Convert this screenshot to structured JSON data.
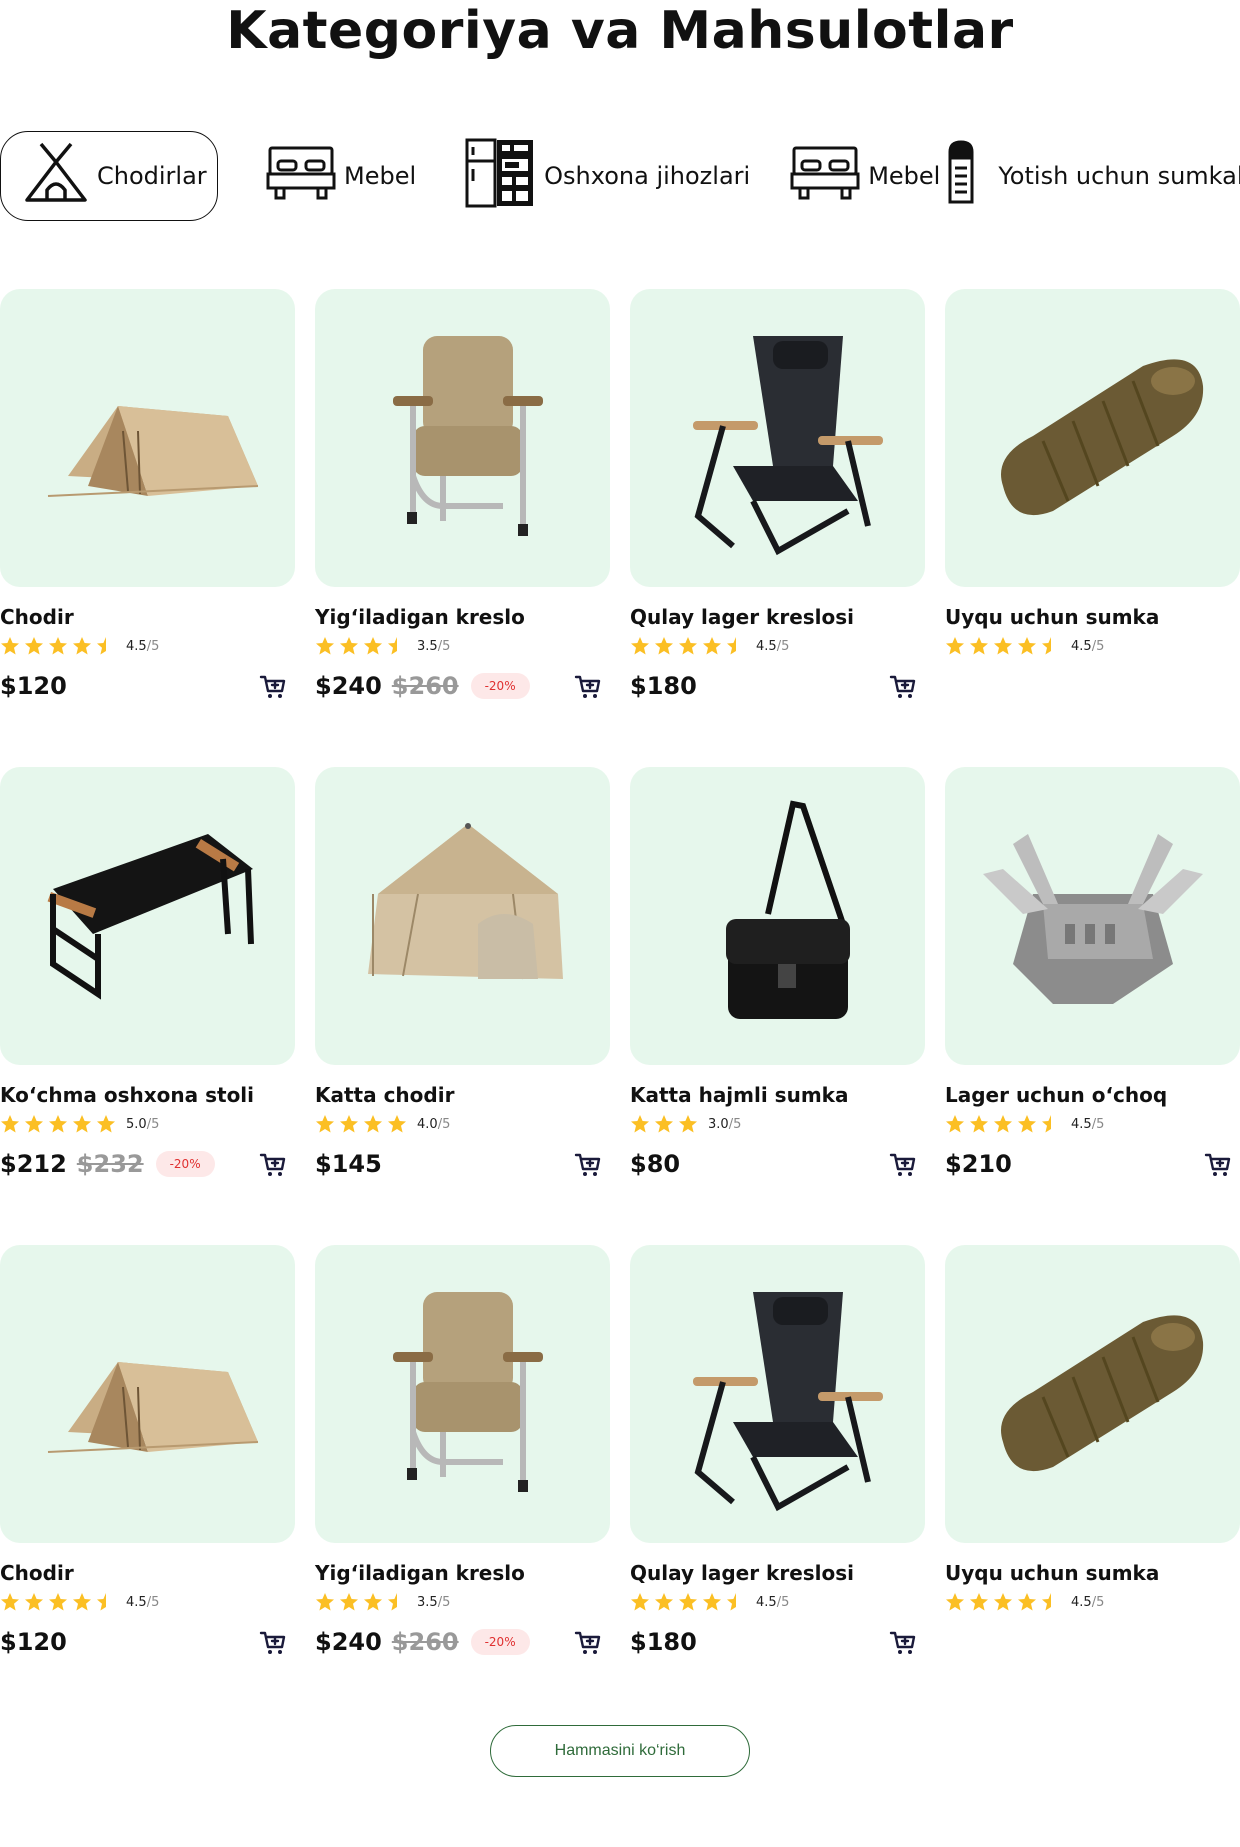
{
  "page": {
    "title": "Kategoriya va Mahsulotlar"
  },
  "categories": [
    {
      "label": "Chodirlar",
      "icon": "tent-icon",
      "active": true
    },
    {
      "label": "Mebel",
      "icon": "bed-icon"
    },
    {
      "label": "Oshxona jihozlari",
      "icon": "kitchen-appliances-icon"
    },
    {
      "label": "Mebel",
      "icon": "bed-icon"
    },
    {
      "label": "Yotish uchun sumkalar",
      "icon": "sleeping-bag-icon"
    }
  ],
  "products": [
    {
      "name": "Chodir",
      "rating": 4.5,
      "rating_text": "4.5",
      "max": "/5",
      "price": "$120",
      "old_price": "",
      "discount": "",
      "image": "small-tent-icon",
      "cart": true
    },
    {
      "name": "Yig‘iladigan kreslo",
      "rating": 3.5,
      "rating_text": "3.5",
      "max": "/5",
      "price": "$240",
      "old_price": "$260",
      "discount": "-20%",
      "image": "folding-chair-icon",
      "cart": true
    },
    {
      "name": "Qulay lager kreslosi",
      "rating": 4.5,
      "rating_text": "4.5",
      "max": "/5",
      "price": "$180",
      "old_price": "",
      "discount": "",
      "image": "camp-chair-icon",
      "cart": true
    },
    {
      "name": "Uyqu uchun sumka",
      "rating": 4.5,
      "rating_text": "4.5",
      "max": "/5",
      "price": "",
      "old_price": "",
      "discount": "",
      "image": "sleeping-bag-icon",
      "cart": false
    },
    {
      "name": "Ko‘chma oshxona stoli",
      "rating": 5.0,
      "rating_text": "5.0",
      "max": "/5",
      "price": "$212",
      "old_price": "$232",
      "discount": "-20%",
      "image": "folding-table-icon",
      "cart": true
    },
    {
      "name": "Katta chodir",
      "rating": 4.0,
      "rating_text": "4.0",
      "max": "/5",
      "price": "$145",
      "old_price": "",
      "discount": "",
      "image": "large-tent-icon",
      "cart": true
    },
    {
      "name": "Katta hajmli sumka",
      "rating": 3.0,
      "rating_text": "3.0",
      "max": "/5",
      "price": "$80",
      "old_price": "",
      "discount": "",
      "image": "shoulder-bag-icon",
      "cart": true
    },
    {
      "name": "Lager uchun o‘choq",
      "rating": 4.5,
      "rating_text": "4.5",
      "max": "/5",
      "price": "$210",
      "old_price": "",
      "discount": "",
      "image": "camp-stove-icon",
      "cart": true
    },
    {
      "name": "Chodir",
      "rating": 4.5,
      "rating_text": "4.5",
      "max": "/5",
      "price": "$120",
      "old_price": "",
      "discount": "",
      "image": "small-tent-icon",
      "cart": true
    },
    {
      "name": "Yig‘iladigan kreslo",
      "rating": 3.5,
      "rating_text": "3.5",
      "max": "/5",
      "price": "$240",
      "old_price": "$260",
      "discount": "-20%",
      "image": "folding-chair-icon",
      "cart": true
    },
    {
      "name": "Qulay lager kreslosi",
      "rating": 4.5,
      "rating_text": "4.5",
      "max": "/5",
      "price": "$180",
      "old_price": "",
      "discount": "",
      "image": "camp-chair-icon",
      "cart": true
    },
    {
      "name": "Uyqu uchun sumka",
      "rating": 4.5,
      "rating_text": "4.5",
      "max": "/5",
      "price": "",
      "old_price": "",
      "discount": "",
      "image": "sleeping-bag-icon",
      "cart": false
    }
  ],
  "view_all": {
    "label": "Hammasini ko‘rish"
  },
  "colors": {
    "card_bg": "#e6f7ec",
    "star": "#fbbf24",
    "discount_bg": "#fde8e8",
    "discount_text": "#e03131",
    "button_green": "#2f6b3a"
  }
}
